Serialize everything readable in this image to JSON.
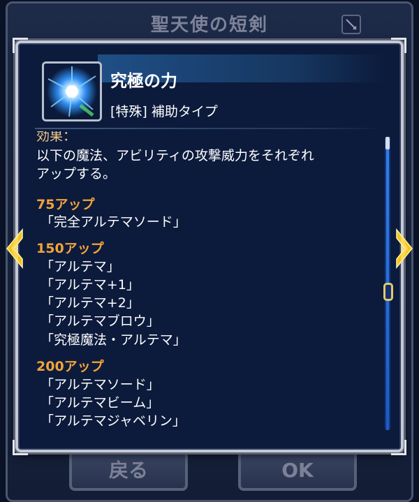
{
  "background": {
    "title": "聖天使の短剣",
    "back_button": "戻る",
    "ok_button": "OK"
  },
  "skill": {
    "name": "究極の力",
    "type": "[特殊] 補助タイプ",
    "icon": "blue-energy-orb-icon"
  },
  "description": {
    "cut_label": "効果：",
    "text_line1": "以下の魔法、アビリティの攻撃威力をそれぞれ",
    "text_line2": "アップする。"
  },
  "groups": [
    {
      "header": "75アップ",
      "items": [
        "「完全アルテマソード」"
      ]
    },
    {
      "header": "150アップ",
      "items": [
        "「アルテマ」",
        "「アルテマ+1」",
        "「アルテマ+2」",
        "「アルテマブロウ」",
        "「究極魔法・アルテマ」"
      ]
    },
    {
      "header": "200アップ",
      "items": [
        "「アルテマソード」",
        "「アルテマビーム」",
        "「アルテマジャベリン」"
      ]
    }
  ],
  "colors": {
    "accent": "#f3a33a",
    "panel": "#0c1b3c",
    "text": "#ffffff",
    "arrow": "#f5c518"
  }
}
